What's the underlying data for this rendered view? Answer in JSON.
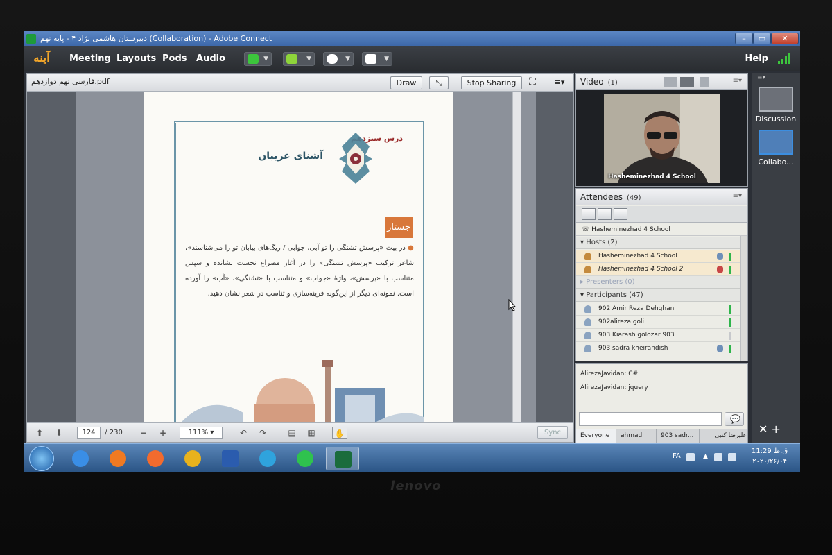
{
  "window": {
    "title": "دبیرستان هاشمی نژاد ۴ - پایه نهم (Collaboration) - Adobe Connect",
    "minimize_glyph": "–",
    "maximize_glyph": "▭",
    "close_glyph": "✕"
  },
  "menubar": {
    "logo_text": "آینه",
    "items": [
      "Meeting",
      "Layouts",
      "Pods",
      "Audio"
    ],
    "tools": [
      {
        "icon": "speaker-icon",
        "color": "#3cc63c"
      },
      {
        "icon": "microphone-icon",
        "color": "#8ed43a"
      },
      {
        "icon": "webcam-icon",
        "color": "#ffffff"
      },
      {
        "icon": "raise-hand-icon",
        "color": "#ffffff"
      }
    ],
    "help": "Help",
    "signal_color": "#3dc63d"
  },
  "share_pod": {
    "filename": "فارسی نهم دوازدهم.pdf",
    "draw_label": "Draw",
    "stop_sharing_label": "Stop Sharing",
    "menu_glyph": "≡▾",
    "document": {
      "lesson_number": "درس سیزدهم",
      "lesson_title": "آشنای غریبان",
      "section_badge": "جستار",
      "body": "در بیت «پرسش تشنگی را تو آبی، جوابی / ریگ‌های بیابان تو را می‌شناسند»، شاعر ترکیب «پرسش تشنگی» را در آغاز مصراع نخست نشانده و سپس متناسب با «پرسش»، واژۀ «جواب» و متناسب با «تشنگی»، «آب» را آورده است. نمونه‌ای دیگر از این‌گونه قرینه‌سازی و تناسب در شعر نشان دهید."
    },
    "footer": {
      "page_current": "124",
      "page_total": "/ 230",
      "zoom": "111%",
      "sync": "Sync"
    }
  },
  "video_pod": {
    "title": "Video",
    "count": "(1)",
    "speaker_name": "Hasheminezhad 4 School"
  },
  "attendees_pod": {
    "title": "Attendees",
    "count": "(49)",
    "me": "Hasheminezhad 4 School",
    "hosts_header": "Hosts (2)",
    "hosts": [
      "Hasheminezhad 4 School",
      "Hasheminezhad 4 School 2"
    ],
    "presenters_header": "Presenters (0)",
    "participants_header": "Participants (47)",
    "participants": [
      "902 Amir Reza Dehghan",
      "902alireza goli",
      "903 Kiarash golozar 903",
      "903 sadra kheirandish"
    ]
  },
  "chat_pod": {
    "messages": [
      {
        "sender": "AlirezaJavidan:",
        "text": "C#"
      },
      {
        "sender": "AlirezaJavidan:",
        "text": "jquery"
      }
    ],
    "tabs": [
      "Everyone",
      "ahmadi",
      "903 sadr...",
      "علیرضا کتبی"
    ]
  },
  "layouts": {
    "items": [
      "Discussion",
      "Collabo..."
    ],
    "tools_glyph": "✕  +"
  },
  "taskbar": {
    "apps": [
      {
        "icon": "internet-explorer-icon",
        "color": "#3a8ee6"
      },
      {
        "icon": "firefox-icon",
        "color": "#f07a22"
      },
      {
        "icon": "media-player-icon",
        "color": "#f26b2e"
      },
      {
        "icon": "chrome-icon",
        "color": "#e8b21d"
      },
      {
        "icon": "word-icon",
        "color": "#2b5cae"
      },
      {
        "icon": "telegram-icon",
        "color": "#2fa3dd"
      },
      {
        "icon": "whatsapp-icon",
        "color": "#2fc24e"
      },
      {
        "icon": "adobe-connect-icon",
        "color": "#1a6c3c"
      }
    ],
    "lang": "FA",
    "time": "11:29 ق.ظ",
    "date": "۲۰۲۰/۲۶/۰۴"
  },
  "laptop": {
    "brand": "lenovo"
  }
}
